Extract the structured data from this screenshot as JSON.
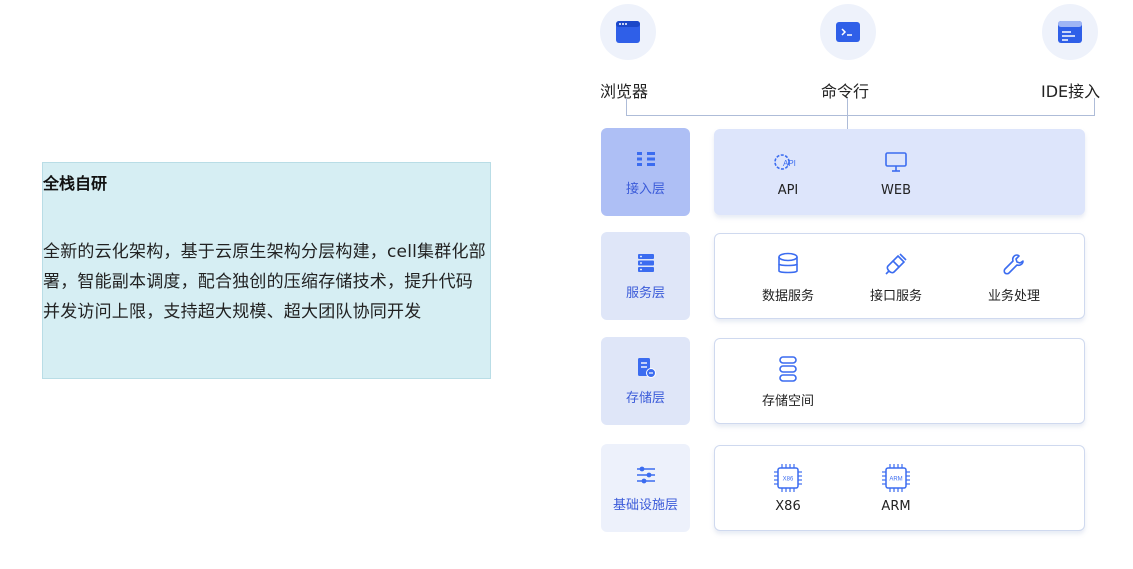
{
  "intro": {
    "title": "全栈自研",
    "body": "全新的云化架构，基于云原生架构分层构建，cell集群化部署，智能副本调度，配合独创的压缩存储技术，提升代码并发访问上限，支持超大规模、超大团队协同开发"
  },
  "clients": [
    {
      "label": "浏览器",
      "icon": "browser-window-icon"
    },
    {
      "label": "命令行",
      "icon": "terminal-icon"
    },
    {
      "label": "IDE接入",
      "icon": "ide-code-icon"
    }
  ],
  "layers": [
    {
      "name": "接入层",
      "icon": "access-layer-icon",
      "items": [
        {
          "label": "API",
          "icon": "api-gear-icon"
        },
        {
          "label": "WEB",
          "icon": "monitor-icon"
        }
      ]
    },
    {
      "name": "服务层",
      "icon": "server-list-icon",
      "items": [
        {
          "label": "数据服务",
          "icon": "database-icon"
        },
        {
          "label": "接口服务",
          "icon": "plug-icon"
        },
        {
          "label": "业务处理",
          "icon": "wrench-icon"
        }
      ]
    },
    {
      "name": "存储层",
      "icon": "storage-doc-icon",
      "items": [
        {
          "label": "存储空间",
          "icon": "storage-stack-icon"
        }
      ]
    },
    {
      "name": "基础设施层",
      "icon": "sliders-icon",
      "items": [
        {
          "label": "X86",
          "icon": "x86-chip-icon",
          "chip_text": "X86"
        },
        {
          "label": "ARM",
          "icon": "arm-chip-icon",
          "chip_text": "ARM"
        }
      ]
    }
  ],
  "colors": {
    "accent": "#3b6cf0",
    "tab_active": "#aebff5",
    "tab_inactive": "#dfe6f8",
    "tab_light": "#edf1fb",
    "access_fill": "#dde5fb",
    "box_border": "#cfd9ef",
    "intro_bg": "#d6eef3"
  }
}
